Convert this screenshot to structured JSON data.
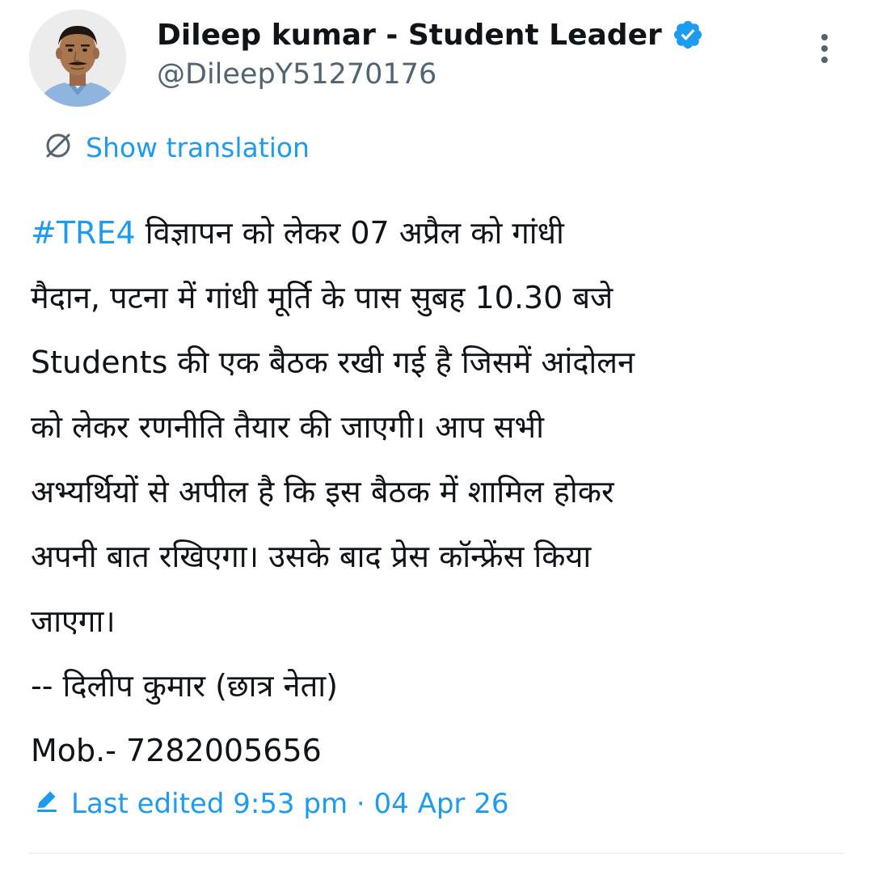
{
  "author": {
    "display_name": "Dileep kumar - Student Leader",
    "handle": "@DileepY51270176",
    "verified": true
  },
  "icons": {
    "verified": "verified-badge-icon",
    "more": "more-vertical-icon",
    "translate": "translate-icon",
    "edit": "edit-pencil-icon"
  },
  "translate": {
    "label": "Show translation"
  },
  "tweet": {
    "hashtag": "#TRE4",
    "body": " विज्ञापन को लेकर 07 अप्रैल को गांधी\nमैदान, पटना में गांधी मूर्ति के पास सुबह 10.30 बजे\nStudents की एक बैठक रखी गई है जिसमें आंदोलन\nको लेकर रणनीति तैयार की जाएगी। आप सभी\nअभ्यर्थियों से अपील है कि इस बैठक में शामिल होकर\nअपनी बात रखिएगा। उसके बाद प्रेस कॉन्फ्रेंस किया\nजाएगा।\n-- दिलीप कुमार (छात्र नेता)\nMob.- 7282005656"
  },
  "edited": {
    "label": "Last edited 9:53 pm · 04 Apr 26"
  },
  "colors": {
    "accent": "#1d9bf0",
    "text": "#0f1419",
    "secondary": "#536471",
    "divider": "#eff3f4"
  }
}
